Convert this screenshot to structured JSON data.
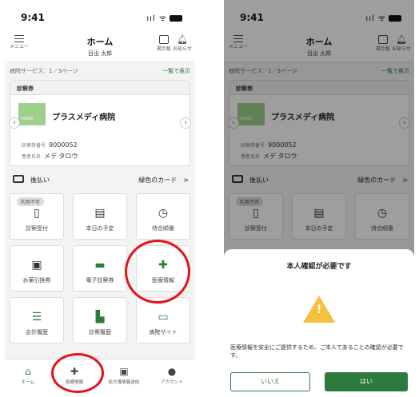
{
  "status": {
    "time": "9:41",
    "signal": "ııl ᯤ"
  },
  "header": {
    "menu_label": "メニュー",
    "title": "ホーム",
    "user": "目出 太郎",
    "notice_label": "掲示板",
    "bell_label": "お知らせ"
  },
  "subheader": {
    "text": "病院サービス：1／3ページ",
    "link": "一覧で表示"
  },
  "card": {
    "header": "診察券",
    "logo_text": "medi",
    "hospital": "プラスメディ病院",
    "prev": "‹",
    "next": "›",
    "number_label": "診察券番号",
    "number_value": "9000052",
    "name_label": "患者氏名",
    "name_value": "メデ タロウ"
  },
  "payment": {
    "label": "後払い",
    "right": "緑色のカード　>"
  },
  "tiles": [
    {
      "label": "診察受付",
      "icon": "▯",
      "badge": "利用不可"
    },
    {
      "label": "本日の予定",
      "icon": "▤"
    },
    {
      "label": "待合順番",
      "icon": "◷"
    },
    {
      "label": "お薬引換券",
      "icon": "▣"
    },
    {
      "label": "電子診察券",
      "icon": "▬"
    },
    {
      "label": "医療情報",
      "icon": "✚"
    },
    {
      "label": "会計履歴",
      "icon": "☰"
    },
    {
      "label": "診察履歴",
      "icon": "▙"
    },
    {
      "label": "病院サイト",
      "icon": "▭"
    }
  ],
  "nav": [
    {
      "label": "ホーム",
      "icon": "⌂"
    },
    {
      "label": "医療情報",
      "icon": "✚"
    },
    {
      "label": "処方箋情報送信",
      "icon": "▣"
    },
    {
      "label": "アカウント",
      "icon": "●"
    }
  ],
  "modal": {
    "title": "本人確認が必要です",
    "body": "医療情報を安全にご提供するため、ご本人であることの確認が必要です。",
    "no": "いいえ",
    "yes": "はい"
  },
  "colors": {
    "accent": "#2c7a3e",
    "highlight": "#e3131b",
    "warning": "#f2c23c"
  }
}
